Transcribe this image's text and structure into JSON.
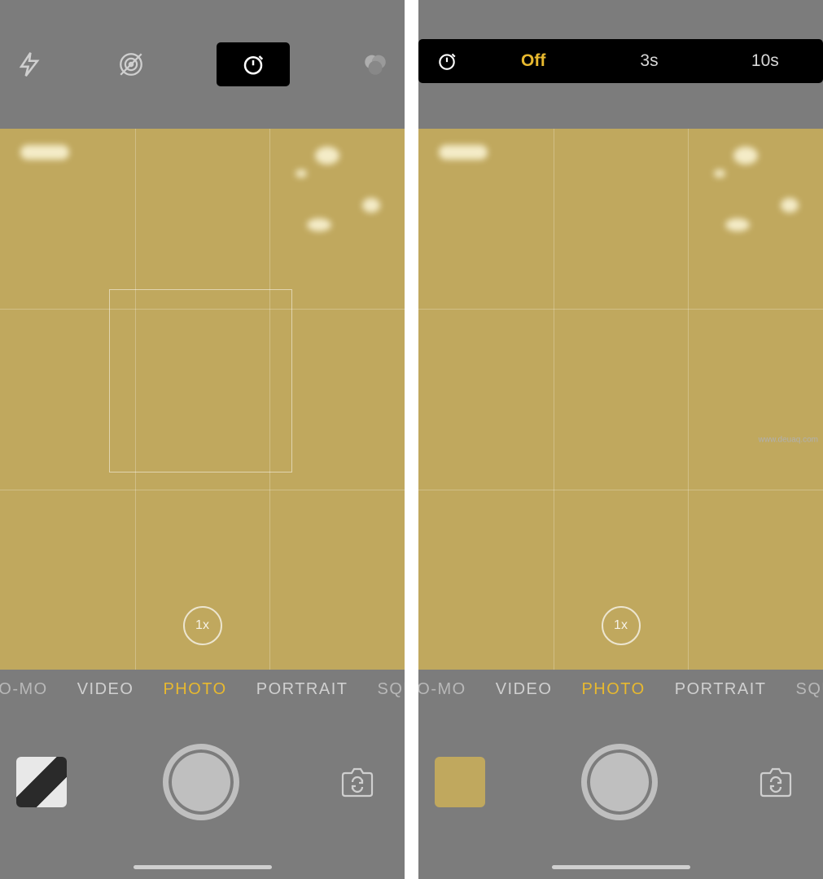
{
  "watermark": "www.deuaq.com",
  "left": {
    "zoom": "1x",
    "modes": [
      "SLO-MO",
      "VIDEO",
      "PHOTO",
      "PORTRAIT",
      "SQUA"
    ],
    "active_mode_index": 2,
    "top_icons": {
      "flash": "flash-icon",
      "live": "live-off-icon",
      "timer": "timer-icon",
      "filters": "filters-icon"
    }
  },
  "right": {
    "zoom": "1x",
    "modes": [
      "SLO-MO",
      "VIDEO",
      "PHOTO",
      "PORTRAIT",
      "SQUA"
    ],
    "active_mode_index": 2,
    "timer_options": {
      "icon": "timer-icon",
      "options": [
        "Off",
        "3s",
        "10s"
      ],
      "active_index": 0
    }
  }
}
